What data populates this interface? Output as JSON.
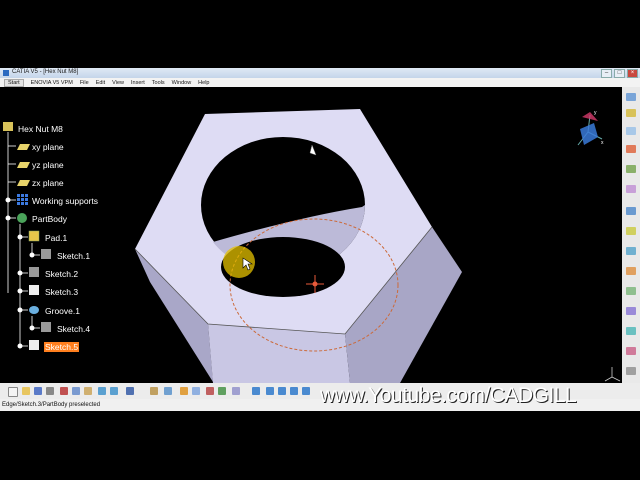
{
  "window": {
    "title": "CATIA V5 - [Hex Nut M8]"
  },
  "menu": [
    "Start",
    "ENOVIA V5 VPM",
    "File",
    "Edit",
    "View",
    "Insert",
    "Tools",
    "Window",
    "Help"
  ],
  "tree": {
    "root": "Hex Nut M8",
    "xy_plane": "xy plane",
    "yz_plane": "yz plane",
    "zx_plane": "zx plane",
    "working_supports": "Working supports",
    "part_body": "PartBody",
    "pad": "Pad.1",
    "sketch1": "Sketch.1",
    "sketch2": "Sketch.2",
    "sketch3": "Sketch.3",
    "groove": "Groove.1",
    "sketch4": "Sketch.4",
    "sketch5": "Sketch.5"
  },
  "compass": {
    "y": "y",
    "x": "x"
  },
  "status": {
    "text": "Edge/Sketch.3/PartBody preselected"
  },
  "watermark": "www.Youtube.com/CADGILL",
  "colors": {
    "nut_face": "#d9d7f0",
    "nut_side": "#b9b7d6",
    "selection": "#ff7f1e",
    "background": "#000000"
  },
  "icons": {
    "plane": "plane-icon",
    "sketch": "sketch-icon",
    "body": "partbody-icon",
    "pad": "pad-icon",
    "groove": "groove-icon",
    "supports": "grid-icon"
  }
}
